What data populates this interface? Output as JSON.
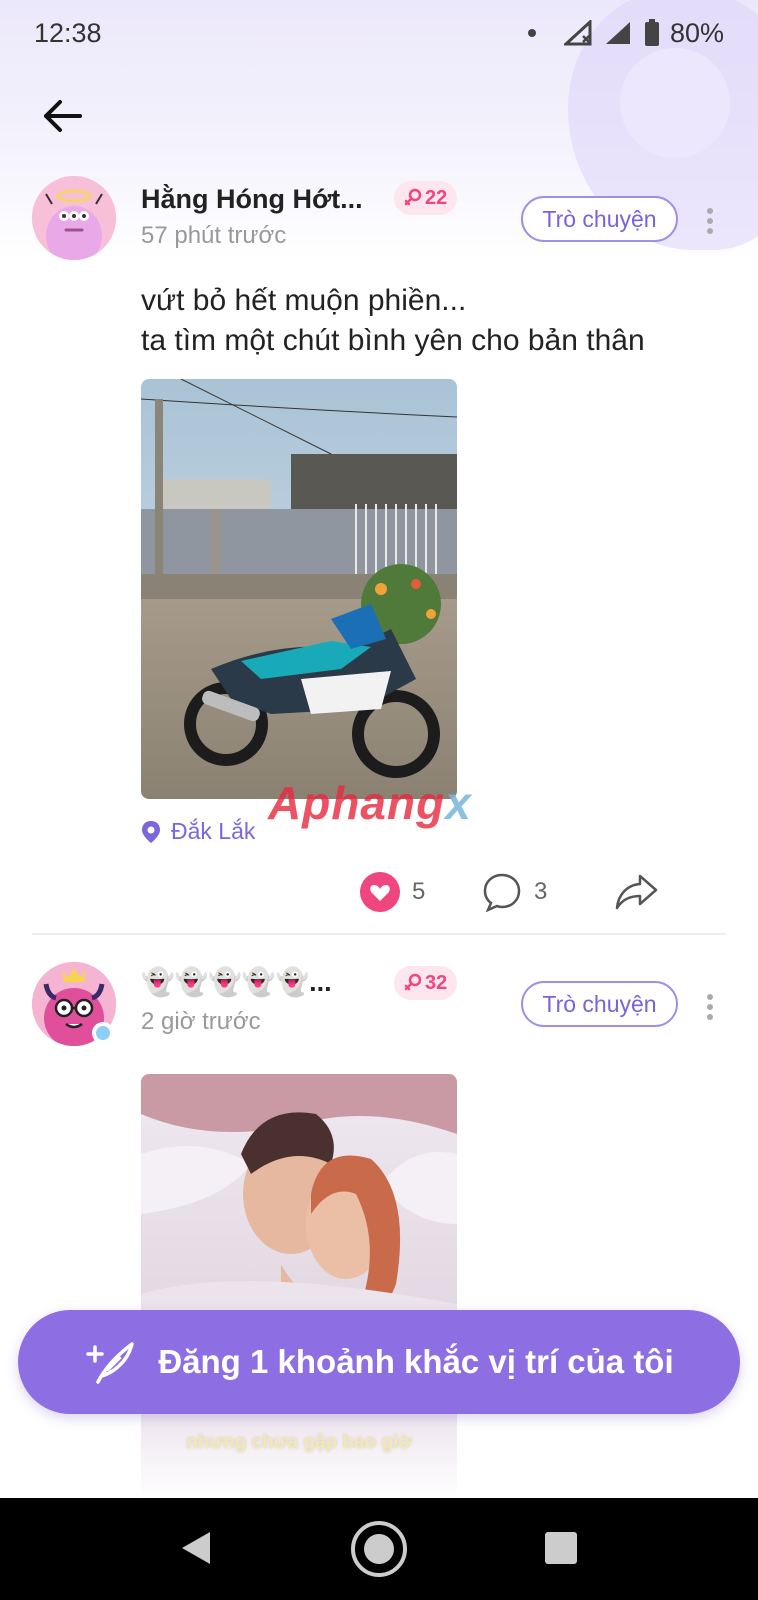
{
  "status_bar": {
    "time": "12:38",
    "battery": "80%"
  },
  "header": {
    "back_icon": "arrow-left-icon"
  },
  "posts": [
    {
      "username": "Hằng Hóng Hớt...",
      "time_ago": "57 phút trước",
      "badge": "22",
      "chat_label": "Trò chuyện",
      "text_line1": "vứt bỏ hết muộn phiền...",
      "text_line2": "ta tìm một chút bình yên cho bản thân",
      "location": "Đắk Lắk",
      "likes": "5",
      "comments": "3"
    },
    {
      "username": "👻👻👻👻👻...",
      "time_ago": "2 giờ trước",
      "badge": "32",
      "chat_label": "Trò chuyện",
      "image_caption": "nhưng chưa gặp bao giờ"
    }
  ],
  "watermark": {
    "main": "Aphang",
    "accent": "x"
  },
  "cta": {
    "label": "Đăng 1 khoảnh khắc vị trí của tôi",
    "icon": "feather-pen-icon"
  },
  "colors": {
    "accent": "#8e6fe3",
    "like": "#f0467f",
    "badge_bg": "#fde6ee"
  }
}
